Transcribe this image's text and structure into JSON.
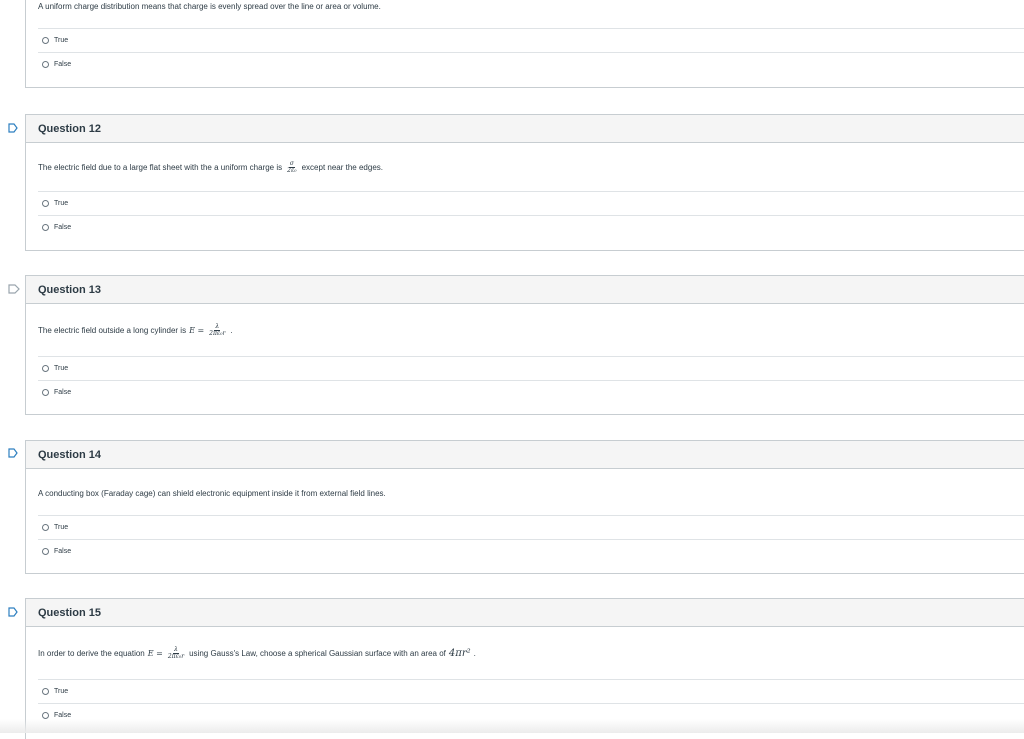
{
  "q11": {
    "text": "A uniform charge distribution means that charge is evenly spread over the line or area or volume.",
    "options": [
      "True",
      "False"
    ]
  },
  "q12": {
    "title": "Question 12",
    "text_before": "The electric field due to a large flat sheet with the a uniform charge is",
    "frac_num": "σ",
    "frac_den": "2ε₀",
    "text_after": "except near the edges.",
    "options": [
      "True",
      "False"
    ]
  },
  "q13": {
    "title": "Question 13",
    "text_before": "The electric field outside a long cylinder is",
    "eq_lhs": "E =",
    "frac_num": "λ",
    "frac_den": "2πε₀r",
    "text_after": ".",
    "options": [
      "True",
      "False"
    ]
  },
  "q14": {
    "title": "Question 14",
    "text": "A conducting box (Faraday cage) can shield electronic equipment inside it from external field lines.",
    "options": [
      "True",
      "False"
    ]
  },
  "q15": {
    "title": "Question 15",
    "text_before": "In order to derive the equation",
    "eq_lhs": "E =",
    "frac_num": "λ",
    "frac_den": "2πε₀r",
    "text_middle": "using Gauss's Law, choose a spherical Gaussian surface with an area of",
    "area": "4πr²",
    "text_after": ".",
    "options": [
      "True",
      "False"
    ]
  },
  "colors": {
    "flag_outline": "#2d7fc0",
    "header_bg": "#f5f5f5",
    "border": "#c7cdd1"
  },
  "icons": {
    "flag": "bookmark-flag-icon",
    "radio": "radio-button-icon"
  }
}
